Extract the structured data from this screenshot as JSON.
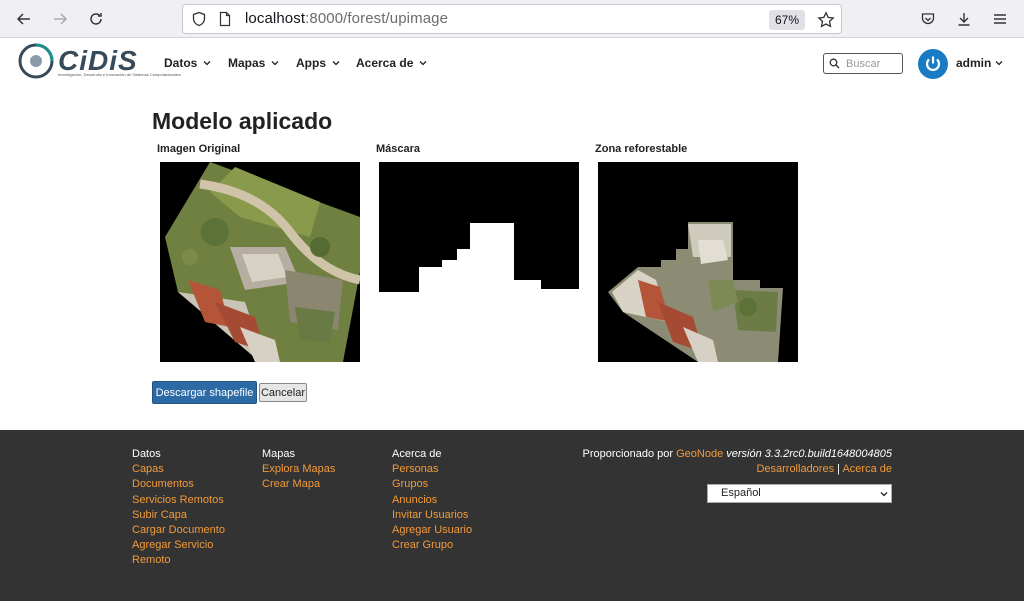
{
  "browser": {
    "url_host": "localhost",
    "url_rest": ":8000/forest/upimage",
    "zoom": "67%"
  },
  "header": {
    "logo_text": "CiDiS",
    "logo_sub": "Investigación, Desarrollo e Innovación de Sistemas Computacionales",
    "nav": [
      "Datos",
      "Mapas",
      "Apps",
      "Acerca de"
    ],
    "search_placeholder": "Buscar",
    "user": "admin"
  },
  "main": {
    "title": "Modelo aplicado",
    "panels": [
      "Imagen Original",
      "Máscara",
      "Zona reforestable"
    ],
    "download_button": "Descargar shapefile",
    "cancel_button": "Cancelar"
  },
  "footer": {
    "col1": {
      "head": "Datos",
      "links": [
        "Capas",
        "Documentos",
        "Servicios Remotos",
        "Subir Capa",
        "Cargar Documento",
        "Agregar Servicio",
        "Remoto"
      ]
    },
    "col2": {
      "head": "Mapas",
      "links": [
        "Explora Mapas",
        "Crear Mapa"
      ]
    },
    "col3": {
      "head": "Acerca de",
      "links": [
        "Personas",
        "Grupos",
        "Anuncios",
        "Invitar Usuarios",
        "Agregar Usuario",
        "Crear Grupo"
      ]
    },
    "powered_by": "Proporcionado por",
    "geonode": "GeoNode",
    "version": "versión 3.3.2rc0.build1648004805",
    "developers": "Desarrolladores",
    "separator": "|",
    "about": "Acerca de",
    "language": "Español"
  },
  "colors": {
    "accent": "#2c6aa5",
    "footer_bg": "#333333",
    "footer_link": "#f29a3a",
    "avatar": "#1a7bc4"
  }
}
